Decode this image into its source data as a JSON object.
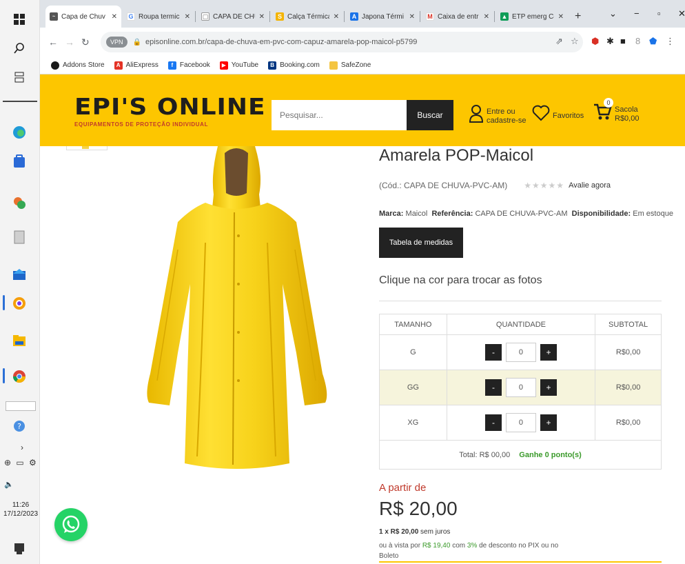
{
  "taskbar": {
    "icons": [
      "windows-icon",
      "search-icon",
      "task-view-icon",
      "edge-icon",
      "store-icon",
      "app-icon",
      "notepad-icon",
      "mail-icon",
      "chromium-icon",
      "files-icon",
      "chrome-icon"
    ],
    "clock_time": "11:26",
    "clock_date": "17/12/2023"
  },
  "browser": {
    "tabs": [
      {
        "label": "Capa de Chuv",
        "active": true,
        "color": "#555"
      },
      {
        "label": "Roupa termic",
        "active": false,
        "color": "#4285f4"
      },
      {
        "label": "CAPA DE CHU",
        "active": false,
        "color": "#777"
      },
      {
        "label": "Calça Térmica",
        "active": false,
        "color": "#f4b400"
      },
      {
        "label": "Japona Térmi",
        "active": false,
        "color": "#1a73e8"
      },
      {
        "label": "Caixa de entr",
        "active": false,
        "color": "#d93025"
      },
      {
        "label": "ETP emerg Co",
        "active": false,
        "color": "#0f9d58"
      }
    ],
    "new_tab": "+",
    "url": "episonline.com.br/capa-de-chuva-em-pvc-com-capuz-amarela-pop-maicol-p5799",
    "bookmarks": [
      {
        "label": "Addons Store",
        "color": "#1a1a1a"
      },
      {
        "label": "AliExpress",
        "color": "#e43225"
      },
      {
        "label": "Facebook",
        "color": "#1877f2"
      },
      {
        "label": "YouTube",
        "color": "#ff0000"
      },
      {
        "label": "Booking.com",
        "color": "#003580"
      },
      {
        "label": "SafeZone",
        "color": "#f4c542"
      }
    ]
  },
  "header": {
    "logo_main": "EPI'S ONLINE",
    "logo_sub": "EQUIPAMENTOS DE PROTEÇÃO INDIVIDUAL",
    "search_placeholder": "Pesquisar...",
    "search_button": "Buscar",
    "login_line1": "Entre ou",
    "login_line2": "cadastre-se",
    "favorites": "Favoritos",
    "cart_count": "0",
    "cart_label": "Sacola",
    "cart_total": "R$0,00",
    "brand_color": "#fdc600"
  },
  "product": {
    "title": "Amarela POP-Maicol",
    "code": "(Cód.: CAPA DE CHUVA-PVC-AM)",
    "rating_stars": 0,
    "rate_now": "Avalie agora",
    "brand_label": "Marca:",
    "brand": "Maicol",
    "ref_label": "Referência:",
    "ref": "CAPA DE CHUVA-PVC-AM",
    "avail_label": "Disponibilidade:",
    "avail": "Em estoque",
    "size_table_button": "Tabela de medidas",
    "color_hint": "Clique na cor para trocar as fotos",
    "grid": {
      "headers": [
        "TAMANHO",
        "QUANTIDADE",
        "SUBTOTAL"
      ],
      "rows": [
        {
          "size": "G",
          "qty": "0",
          "subtotal": "R$0,00"
        },
        {
          "size": "GG",
          "qty": "0",
          "subtotal": "R$0,00"
        },
        {
          "size": "XG",
          "qty": "0",
          "subtotal": "R$0,00"
        }
      ],
      "minus": "-",
      "plus": "+",
      "total": "Total: R$ 00,00",
      "points": "Ganhe 0 ponto(s)"
    },
    "price_from": "A partir de",
    "price": "R$ 20,00",
    "installments_bold": "1 x R$ 20,00",
    "installments_rest": "sem juros",
    "pix_a": "ou à vista por",
    "pix_price": "R$ 19,40",
    "pix_b": "com",
    "pix_pct": "3%",
    "pix_c": "de desconto no PIX ou no",
    "pix_d": "Boleto"
  }
}
